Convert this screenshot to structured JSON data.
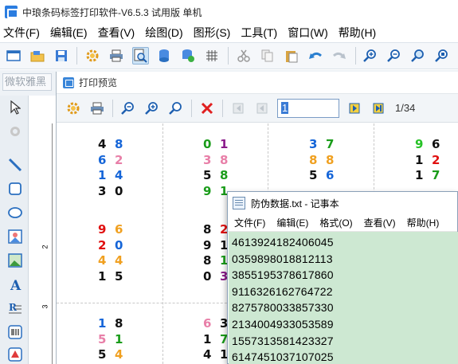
{
  "window": {
    "title": "中琅条码标签打印软件-V6.5.3 试用版 单机"
  },
  "menu": [
    "文件(F)",
    "编辑(E)",
    "查看(V)",
    "绘图(D)",
    "图形(S)",
    "工具(T)",
    "窗口(W)",
    "帮助(H)"
  ],
  "font": {
    "value": "微软雅黑"
  },
  "ruler": {
    "mark1": "1",
    "mark2": "2",
    "mark3": "3"
  },
  "preview": {
    "title": "打印预览",
    "page_value": "1",
    "page_total": "1/34"
  },
  "colors": {
    "blue": "#1565d8",
    "green": "#1a9c1a",
    "purple": "#8a1a8a",
    "pink": "#e87fa8",
    "orange": "#f0a020",
    "red": "#e01010",
    "black": "#111111",
    "bright_green": "#26c226"
  },
  "labels": [
    {
      "rows": [
        [
          [
            "4",
            "black"
          ],
          [
            "8",
            "blue"
          ]
        ],
        [
          [
            "6",
            "blue"
          ],
          [
            "2",
            "pink"
          ]
        ],
        [
          [
            "1",
            "blue"
          ],
          [
            "4",
            "blue"
          ]
        ],
        [
          [
            "3",
            "black"
          ],
          [
            "0",
            "black"
          ]
        ]
      ]
    },
    {
      "rows": [
        [
          [
            "0",
            "green"
          ],
          [
            "1",
            "purple"
          ]
        ],
        [
          [
            "3",
            "pink"
          ],
          [
            "8",
            "pink"
          ]
        ],
        [
          [
            "5",
            "black"
          ],
          [
            "8",
            "green"
          ]
        ],
        [
          [
            "9",
            "green"
          ],
          [
            "1",
            "green"
          ]
        ]
      ]
    },
    {
      "rows": [
        [
          [
            "3",
            "blue"
          ],
          [
            "7",
            "green"
          ]
        ],
        [
          [
            "8",
            "orange"
          ],
          [
            "8",
            "orange"
          ]
        ],
        [
          [
            "5",
            "black"
          ],
          [
            "6",
            "blue"
          ]
        ]
      ]
    },
    {
      "rows": [
        [
          [
            "9",
            "bright_green"
          ],
          [
            "6",
            "black"
          ]
        ],
        [
          [
            "1",
            "black"
          ],
          [
            "2",
            "red"
          ]
        ],
        [
          [
            "1",
            "black"
          ],
          [
            "7",
            "green"
          ]
        ]
      ]
    },
    {
      "rows": [
        [
          [
            "9",
            "red"
          ],
          [
            "6",
            "orange"
          ]
        ],
        [
          [
            "2",
            "red"
          ],
          [
            "0",
            "blue"
          ]
        ],
        [
          [
            "4",
            "orange"
          ],
          [
            "4",
            "orange"
          ]
        ],
        [
          [
            "1",
            "black"
          ],
          [
            "5",
            "black"
          ]
        ]
      ]
    },
    {
      "rows": [
        [
          [
            "8",
            "black"
          ],
          [
            "2",
            "red"
          ]
        ],
        [
          [
            "9",
            "black"
          ],
          [
            "1",
            "black"
          ]
        ],
        [
          [
            "8",
            "black"
          ],
          [
            "1",
            "green"
          ]
        ],
        [
          [
            "0",
            "black"
          ],
          [
            "3",
            "purple"
          ]
        ]
      ]
    },
    {
      "rows": [
        [
          [
            "1",
            "blue"
          ],
          [
            "8",
            "black"
          ]
        ],
        [
          [
            "5",
            "pink"
          ],
          [
            "1",
            "green"
          ]
        ],
        [
          [
            "5",
            "black"
          ],
          [
            "4",
            "orange"
          ]
        ]
      ]
    },
    {
      "rows": [
        [
          [
            "6",
            "pink"
          ],
          [
            "3",
            "black"
          ]
        ],
        [
          [
            "1",
            "black"
          ],
          [
            "7",
            "green"
          ]
        ],
        [
          [
            "4",
            "black"
          ],
          [
            "1",
            "black"
          ]
        ]
      ]
    }
  ],
  "notepad": {
    "title": "防伪数据.txt - 记事本",
    "menu": [
      "文件(F)",
      "编辑(E)",
      "格式(O)",
      "查看(V)",
      "帮助(H)"
    ],
    "lines": [
      "4613924182406045",
      "0359898018812113",
      "3855195378617860",
      "9116326162764722",
      "8275780033857330",
      "2134004933053589",
      "1557313581423327",
      "6147451037107025"
    ]
  }
}
